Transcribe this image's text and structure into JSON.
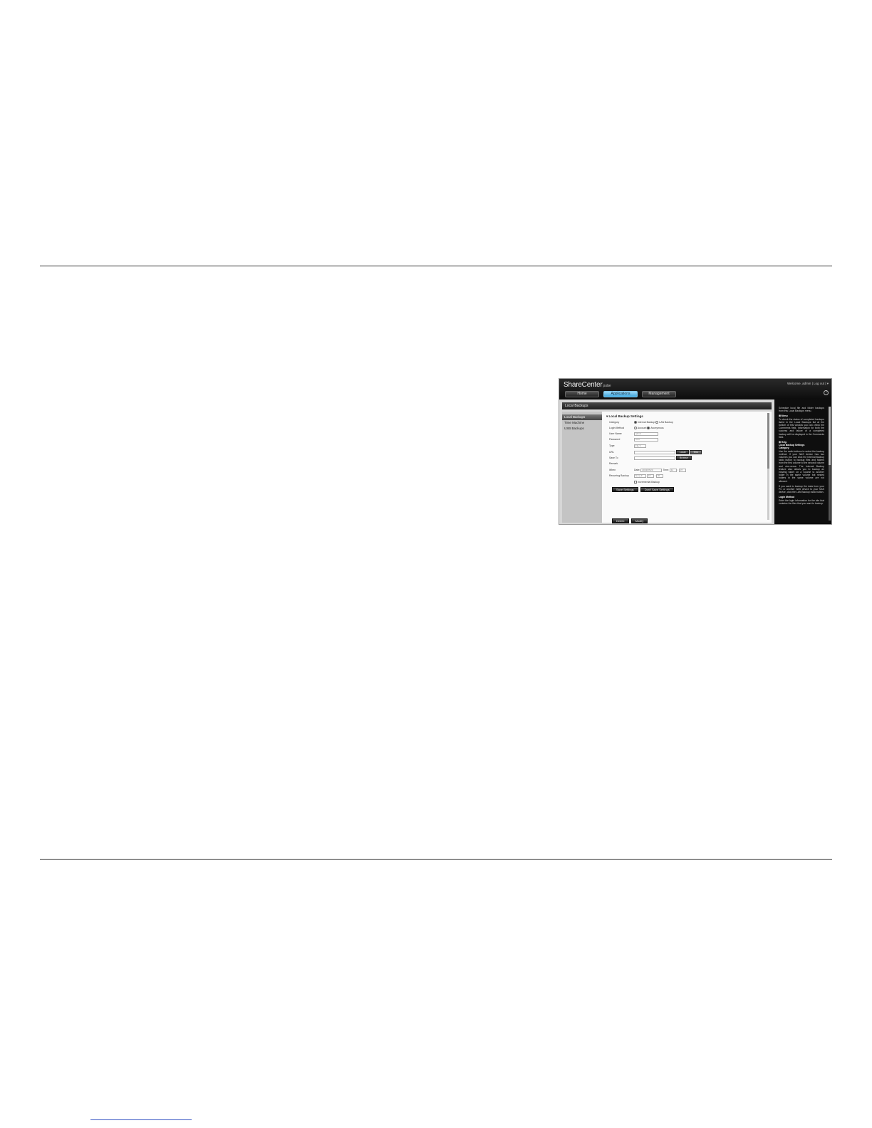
{
  "screenshot": {
    "app": {
      "logo": "ShareCenter",
      "logo_sub": "pulse",
      "welcome": "Welcome, admin | Log out | ▾",
      "help_icon": "?"
    },
    "nav_tabs": [
      "Home",
      "Applications",
      "Management"
    ],
    "panel_title": "Local Backups",
    "sidebar": [
      "Local Backups",
      "Time Machine",
      "USB Backups"
    ],
    "section_title": "Local Backup Settings",
    "form": {
      "category_label": "Category",
      "category_opt1": "Internal Backup",
      "category_opt2": "LAN Backup",
      "login_label": "Login Method",
      "login_opt1": "Account",
      "login_opt2": "Anonymous",
      "username_label": "User Name",
      "username_value": "admin",
      "password_label": "Password",
      "password_value": "••••••",
      "type_label": "Type",
      "type_value": "File",
      "url_label": "URL",
      "local_button": "Local",
      "test_button": "Test",
      "saveto_label": "Save To",
      "browse_button": "Browse",
      "remark_label": "Remark",
      "when_label": "When",
      "date_label": "Date:",
      "date_value": "2013/07/23",
      "time_label": "Time:",
      "time_hour": "11",
      "time_min": "37",
      "recurring_label": "Recurring Backup",
      "recurring_value": "None",
      "recurring_x1": "10",
      "recurring_x2": "00",
      "incremental_label": "Incremental Backup"
    },
    "buttons": {
      "save": "Save Settings",
      "dont_save": "Don't Save Settings",
      "b1": "Delete",
      "b2": "Modify"
    },
    "help": {
      "intro": "Schedule local file and folder backups from this Local Backups menu.",
      "menu_title": "Menu",
      "menu_text": "To check the status of completed backups listed in the Local Backups list at the bottom of this window you can check the Comments field. Information for both the success and failure of a completed backup will be displayed in the Comments field.",
      "help_title": "Help",
      "settings_title": "Local Backup Settings",
      "category_title": "Category",
      "category_text": "Use the radio buttons to select the backup method. If your NAS device has two volumes you can click the Internal Backup radio button to backup files and folders from the first volume to the second volume and vice-versa. The Internal Backup feature also allows you to backup an existing folder on a volume to another folder in the same volume but nested folders in the same volume are not allowed.",
      "lan_text": "If you want to backup the data from your PC or another NAS device to your NAS device, click the LAN Backup radio button.",
      "login_title": "Login Method",
      "login_text": "Enter the login information for the site that contains the files that you want to backup."
    }
  }
}
